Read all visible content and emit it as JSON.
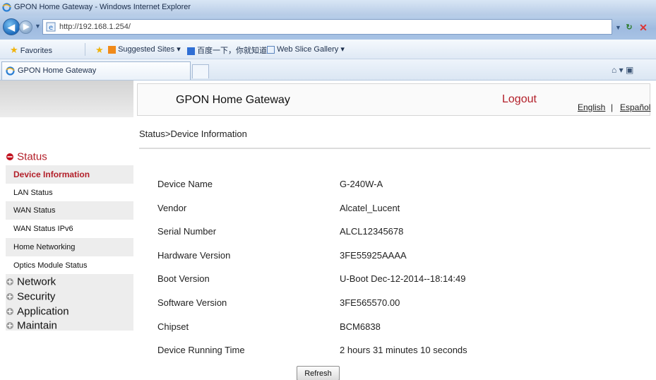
{
  "browser": {
    "window_title": "GPON Home Gateway - Windows Internet Explorer",
    "url": "http://192.168.1.254/",
    "favorites": {
      "favorites_label": "Favorites",
      "suggested_sites_label": "Suggested Sites ▾",
      "baidu_label": "百度一下，你就知道",
      "web_slice_label": "Web Slice Gallery ▾"
    },
    "tab_label": "GPON Home Gateway",
    "toolbar_tools": "▾"
  },
  "header": {
    "title": "GPON Home Gateway",
    "logout_label": "Logout",
    "lang_english": "English",
    "lang_separator": "|",
    "lang_espanol": "Español"
  },
  "breadcrumb": "Status>Device Information",
  "sidebar": {
    "status_label": "Status",
    "sub_items": [
      "Device Information",
      "LAN Status",
      "WAN Status",
      "WAN Status IPv6",
      "Home Networking",
      "Optics Module Status"
    ],
    "groups": [
      "Network",
      "Security",
      "Application",
      "Maintain"
    ]
  },
  "device_info": [
    {
      "label": "Device Name",
      "value": "G-240W-A"
    },
    {
      "label": "Vendor",
      "value": "Alcatel_Lucent"
    },
    {
      "label": "Serial Number",
      "value": "ALCL12345678"
    },
    {
      "label": "Hardware Version",
      "value": "3FE55925AAAA"
    },
    {
      "label": "Boot Version",
      "value": "U-Boot Dec-12-2014--18:14:49"
    },
    {
      "label": "Software Version",
      "value": "3FE565570.00"
    },
    {
      "label": "Chipset",
      "value": "BCM6838"
    },
    {
      "label": "Device Running Time",
      "value": "2 hours 31 minutes 10 seconds"
    }
  ],
  "refresh_button_label": "Refresh",
  "colors": {
    "accent_red": "#b3202a",
    "sidebar_alt_row": "#ededed"
  }
}
